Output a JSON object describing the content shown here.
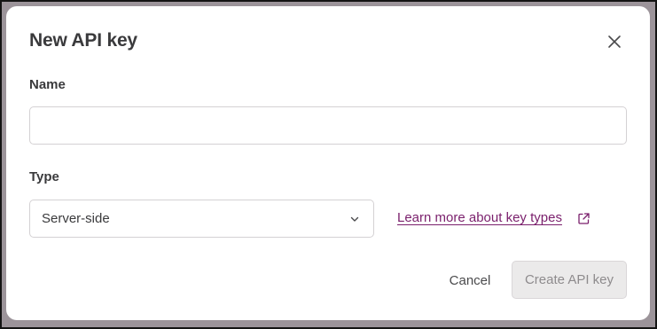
{
  "dialog": {
    "title": "New API key",
    "close_icon": "close-icon"
  },
  "form": {
    "name_label": "Name",
    "name_value": "",
    "name_placeholder": "",
    "type_label": "Type",
    "type_selected": "Server-side",
    "type_chevron_icon": "chevron-down-icon",
    "learn_more_text": "Learn more about key types",
    "learn_more_icon": "external-link-icon"
  },
  "actions": {
    "cancel_label": "Cancel",
    "create_label": "Create API key",
    "create_disabled": true
  },
  "colors": {
    "link": "#7a1f6c",
    "backdrop": "#9c949a",
    "disabled_button_bg": "#ebeaea",
    "disabled_button_text": "#8e8b8d"
  }
}
